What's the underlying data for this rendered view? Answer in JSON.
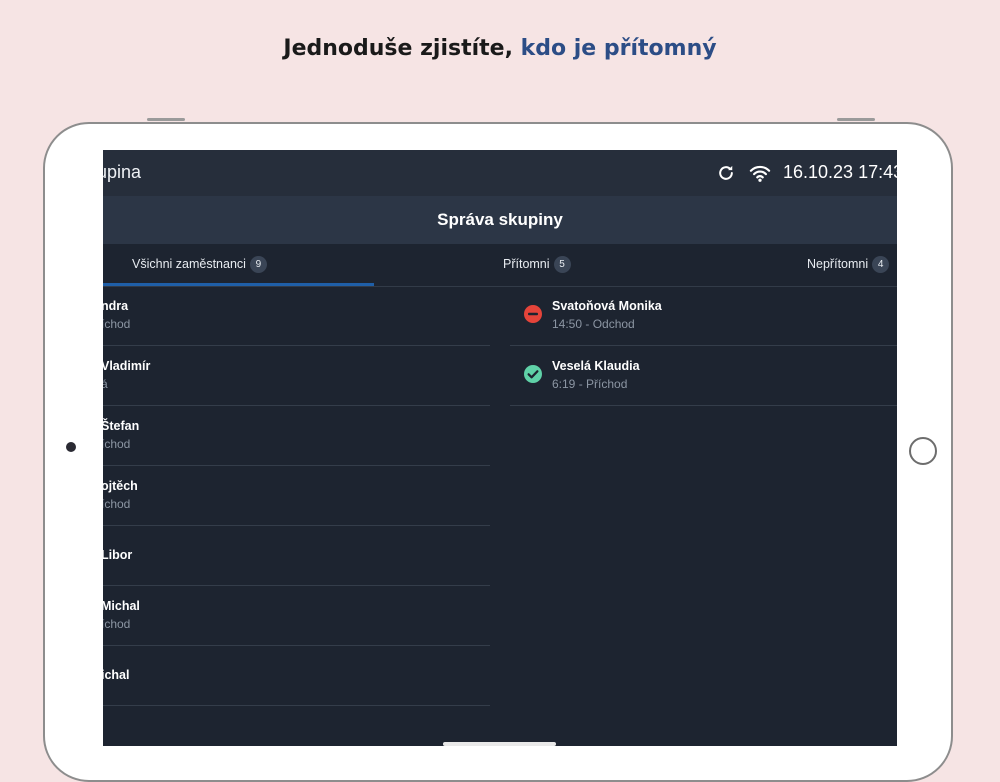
{
  "headline": {
    "part1": "Jednoduše zjistíte, ",
    "part2": "kdo je přítomný"
  },
  "statusbar": {
    "title": "upina",
    "clock": "16.10.23 17:43",
    "refresh_icon": "refresh-icon",
    "wifi_icon": "wifi-icon"
  },
  "page": {
    "title": "Správa skupiny"
  },
  "tabs": [
    {
      "label": "Všichni zaměstnanci",
      "count": "9",
      "active": true
    },
    {
      "label": "Přítomni",
      "count": "5",
      "active": false
    },
    {
      "label": "Nepřítomni",
      "count": "4",
      "active": false
    }
  ],
  "left_list": [
    {
      "name": "ndra",
      "sub": "íchod"
    },
    {
      "name": "Vladimír",
      "sub": "á"
    },
    {
      "name": "Štefan",
      "sub": "íchod"
    },
    {
      "name": "ojtěch",
      "sub": "íchod"
    },
    {
      "name": "Libor",
      "sub": ""
    },
    {
      "name": "Michal",
      "sub": "íchod"
    },
    {
      "name": "ichal",
      "sub": ""
    }
  ],
  "right_list": [
    {
      "name": "Svatoňová Monika",
      "sub": "14:50 - Odchod",
      "status": "absent",
      "icon": "minus-circle-icon"
    },
    {
      "name": "Veselá Klaudia",
      "sub": "6:19 - Příchod",
      "status": "present",
      "icon": "check-circle-icon"
    }
  ],
  "colors": {
    "accent_text": "#2c4d86",
    "tab_underline": "#1f5fa8",
    "absent": "#e5443a",
    "present": "#5fd1a7"
  }
}
